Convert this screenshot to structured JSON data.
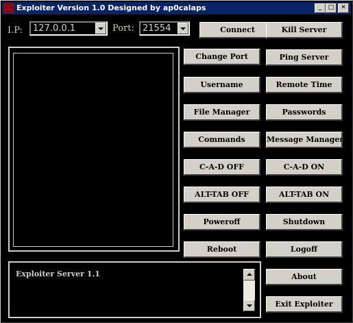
{
  "window": {
    "title": "Exploiter Version 1.0  Designed by ap0calaps",
    "controls": [
      "_",
      "□",
      "✕"
    ]
  },
  "connection": {
    "ip_label": "I.P:",
    "ip_value": "127.0.0.1",
    "port_label": "Port:",
    "port_value": "21554"
  },
  "buttons": {
    "connect": "Connect",
    "kill_server": "Kill Server",
    "change_port": "Change Port",
    "ping_server": "Ping Server",
    "username": "Username",
    "remote_time": "Remote Time",
    "file_manager": "File Manager",
    "passwords": "Passwords",
    "commands": "Commands",
    "message_manager": "Message Manager",
    "cad_off": "C-A-D OFF",
    "cad_on": "C-A-D ON",
    "alttab_off": "ALT-TAB OFF",
    "alttab_on": "ALT-TAB ON",
    "poweroff": "Poweroff",
    "shutdown": "Shutdown",
    "reboot": "Reboot",
    "logoff": "Logoff",
    "about": "About",
    "exit": "Exit Exploiter"
  },
  "log": {
    "text": "Exploiter Server 1.1"
  },
  "colors": {
    "background": "#000000",
    "face": "#d4d0c8",
    "titlebar": "#0a246a"
  }
}
